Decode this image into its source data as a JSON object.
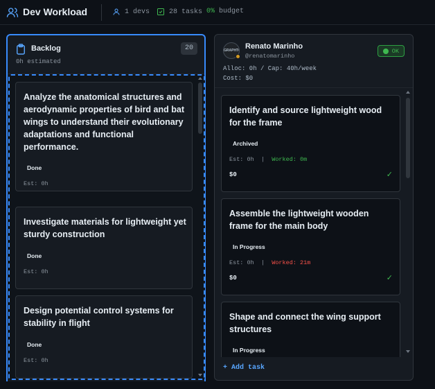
{
  "header": {
    "title": "Dev Workload",
    "devs": "1 devs",
    "tasks": "28 tasks",
    "budget_value": "0%",
    "budget_label": " budget"
  },
  "backlog": {
    "title": "Backlog",
    "estimated": "0h estimated",
    "count": "20",
    "cards": [
      {
        "title": "Analyze the anatomical structures and aerodynamic properties of bird and bat wings to understand their evolutionary adaptations and functional performance.",
        "status": "Done",
        "est": "Est: 0h"
      },
      {
        "title": "Investigate materials for lightweight yet sturdy construction",
        "status": "Done",
        "est": "Est: 0h"
      },
      {
        "title": "Design potential control systems for stability in flight",
        "status": "Done",
        "est": "Est: 0h"
      }
    ]
  },
  "dev": {
    "avatar_text": "GRAPHTON",
    "name": "Renato Marinho",
    "handle": "@renatomarinho",
    "status": "OK",
    "alloc": "Alloc: 0h / Cap: 40h/week",
    "cost": "Cost: $0",
    "tasks": [
      {
        "title": "Identify and source lightweight wood for the frame",
        "status": "Archived",
        "est": "Est: 0h",
        "worked": "Worked: 0m",
        "cost": "$0",
        "check": "✓"
      },
      {
        "title": "Assemble the lightweight wooden frame for the main body",
        "status": "In Progress",
        "est": "Est: 0h",
        "worked": "Worked: 21m",
        "cost": "$0",
        "check": "✓"
      },
      {
        "title": "Shape and connect the wing support structures",
        "status": "In Progress"
      }
    ],
    "add_task": "+ Add task"
  },
  "colors": {
    "accent": "#388bfd",
    "ok": "#3fb950",
    "warn": "#f85149"
  }
}
